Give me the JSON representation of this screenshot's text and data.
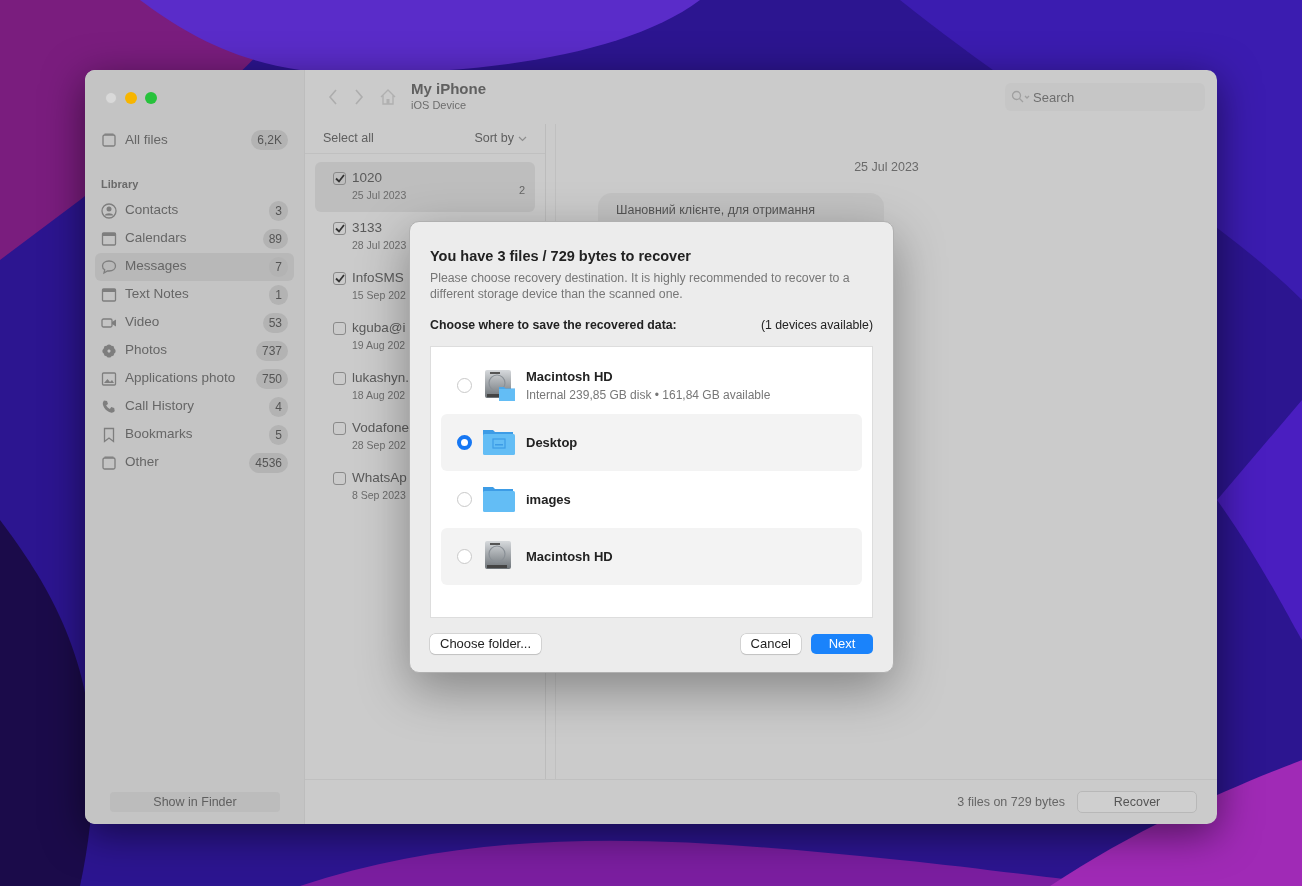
{
  "sidebar": {
    "all_files": {
      "label": "All files",
      "count": "6,2K",
      "selected": false
    },
    "section": "Library",
    "items": [
      {
        "label": "Contacts",
        "count": "3",
        "selected": false
      },
      {
        "label": "Calendars",
        "count": "89",
        "selected": false
      },
      {
        "label": "Messages",
        "count": "7",
        "selected": true
      },
      {
        "label": "Text Notes",
        "count": "1",
        "selected": false
      },
      {
        "label": "Video",
        "count": "53",
        "selected": false
      },
      {
        "label": "Photos",
        "count": "737",
        "selected": false
      },
      {
        "label": "Applications photo",
        "count": "750",
        "selected": false
      },
      {
        "label": "Call History",
        "count": "4",
        "selected": false
      },
      {
        "label": "Bookmarks",
        "count": "5",
        "selected": false
      },
      {
        "label": "Other",
        "count": "4536",
        "selected": false
      }
    ],
    "footer_button": "Show in Finder"
  },
  "toolbar": {
    "title": "My iPhone",
    "subtitle": "iOS Device",
    "search": {
      "placeholder": "Search"
    }
  },
  "list": {
    "select_all": "Select all",
    "sort_by": "Sort by",
    "items": [
      {
        "name": "1020",
        "date": "25 Jul 2023",
        "count": "2",
        "checked": true,
        "selected": true
      },
      {
        "name": "3133",
        "date": "28 Jul 2023",
        "checked": true,
        "selected": false
      },
      {
        "name": "InfoSMS",
        "date": "15 Sep 202",
        "checked": true,
        "selected": false
      },
      {
        "name": "kguba@i",
        "date": "19 Aug 202",
        "checked": false,
        "selected": false
      },
      {
        "name": "lukashyn.",
        "date": "18 Aug 202",
        "checked": false,
        "selected": false
      },
      {
        "name": "Vodafone",
        "date": "28 Sep 202",
        "checked": false,
        "selected": false
      },
      {
        "name": "WhatsAp",
        "date": "8 Sep 2023",
        "checked": false,
        "selected": false
      }
    ]
  },
  "detail": {
    "date": "25 Jul 2023",
    "message": "Шановний клієнте, для отримання"
  },
  "footer": {
    "summary": "3 files on 729 bytes",
    "button": "Recover"
  },
  "dialog": {
    "title": "You have 3 files / 729 bytes to recover",
    "description": "Please choose recovery destination. It is highly recommended to recover to a different storage device than the scanned one.",
    "prompt": "Choose where to save the recovered data:",
    "devices_note": "(1 devices available)",
    "destinations": [
      {
        "kind": "volume",
        "name": "Macintosh HD",
        "detail": "Internal 239,85 GB disk • 161,84 GB available",
        "selected": false
      },
      {
        "kind": "desktop",
        "name": "Desktop",
        "selected": true
      },
      {
        "kind": "folder",
        "name": "images",
        "selected": false
      },
      {
        "kind": "disk",
        "name": "Macintosh HD",
        "selected": false
      }
    ],
    "choose_folder": "Choose folder...",
    "cancel": "Cancel",
    "next": "Next"
  }
}
